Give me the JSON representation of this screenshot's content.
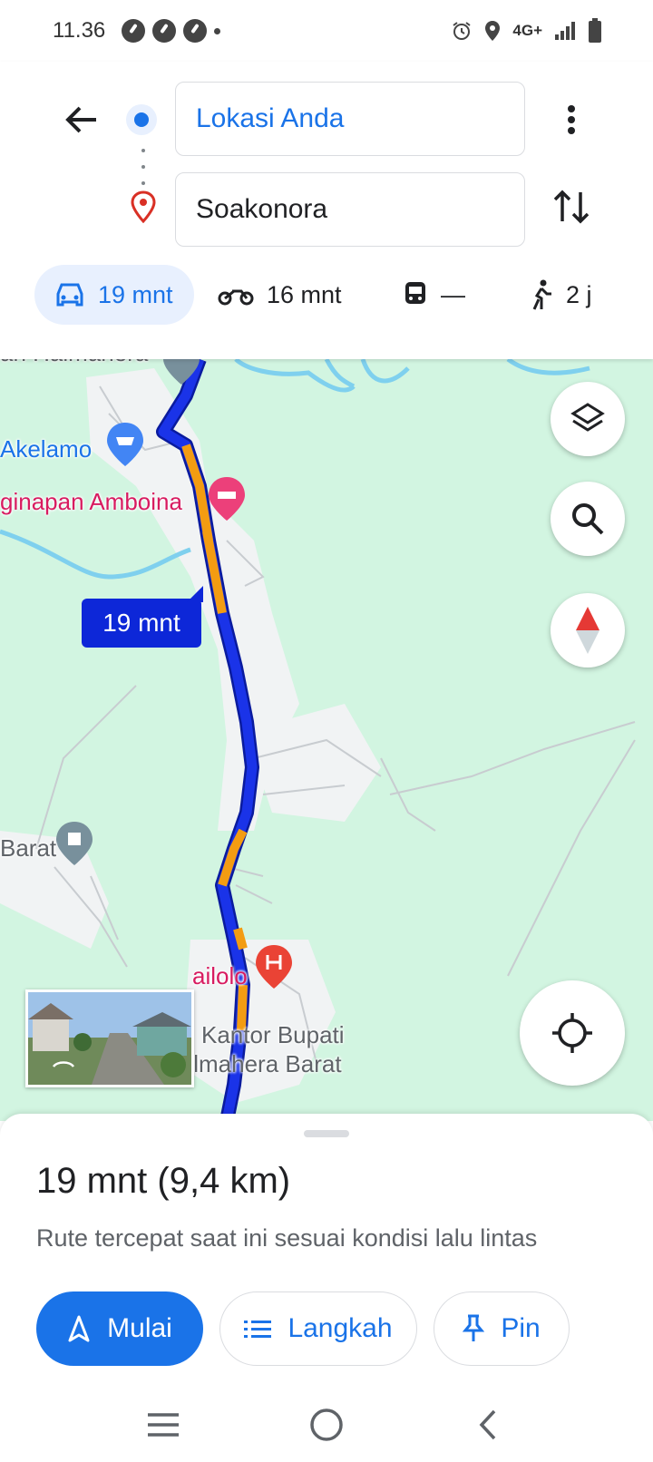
{
  "status_bar": {
    "time": "11.36",
    "network": "4G+"
  },
  "search": {
    "origin": "Lokasi Anda",
    "destination": "Soakonora"
  },
  "modes": [
    {
      "name": "car",
      "label": "19 mnt"
    },
    {
      "name": "motorcycle",
      "label": "16 mnt"
    },
    {
      "name": "transit",
      "label": "—"
    },
    {
      "name": "walk",
      "label": "2 j"
    }
  ],
  "map": {
    "places": [
      "an Halmahera",
      "Akelamo",
      "ginapan Amboina",
      "Barat",
      "ailolo",
      "Kantor Bupati",
      "Halmahera Barat"
    ],
    "route_label": "19 mnt"
  },
  "route": {
    "summary": "19 mnt (9,4 km)",
    "description": "Rute tercepat saat ini sesuai kondisi lalu lintas",
    "start_label": "Mulai",
    "steps_label": "Langkah",
    "pin_label": "Pin"
  },
  "colors": {
    "accent": "#1a73e8",
    "route": "#1a33e8",
    "traffic": "#f39c12",
    "map_bg": "#d2f5e1"
  }
}
